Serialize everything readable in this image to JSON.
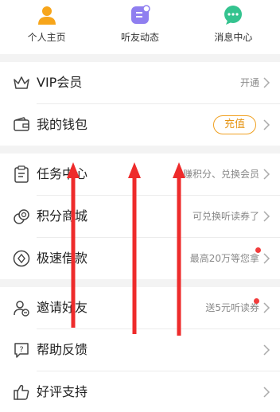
{
  "colors": {
    "accent_orange": "#f7a51a",
    "accent_purple": "#8f7ef0",
    "accent_green": "#34c38f",
    "annotation_red": "#ee2b2b",
    "badge_red": "#f23c3c",
    "section_gap": "#f3f3f3"
  },
  "top_nav": [
    {
      "label": "个人主页",
      "icon": "person-icon"
    },
    {
      "label": "听友动态",
      "icon": "feed-icon"
    },
    {
      "label": "消息中心",
      "icon": "chat-bubble-icon"
    }
  ],
  "menu": {
    "vip": {
      "label": "VIP会员",
      "hint": "开通",
      "icon": "crown-icon"
    },
    "wallet": {
      "label": "我的钱包",
      "button": "充值",
      "icon": "wallet-icon"
    },
    "tasks": {
      "label": "任务中心",
      "hint": "赚积分、兑换会员",
      "icon": "clipboard-icon"
    },
    "points_mall": {
      "label": "积分商城",
      "hint": "可兑换听读券了",
      "icon": "coins-icon"
    },
    "loan": {
      "label": "极速借款",
      "hint": "最高20万等您拿",
      "icon": "diamond-icon",
      "has_dot": true
    },
    "invite": {
      "label": "邀请好友",
      "hint": "送5元听读券",
      "icon": "invite-user-icon",
      "has_dot": true
    },
    "help": {
      "label": "帮助反馈",
      "icon": "help-bubble-icon"
    },
    "review": {
      "label": "好评支持",
      "icon": "thumbs-up-icon"
    }
  },
  "annotations": {
    "arrow_count": 3,
    "direction": "up"
  }
}
